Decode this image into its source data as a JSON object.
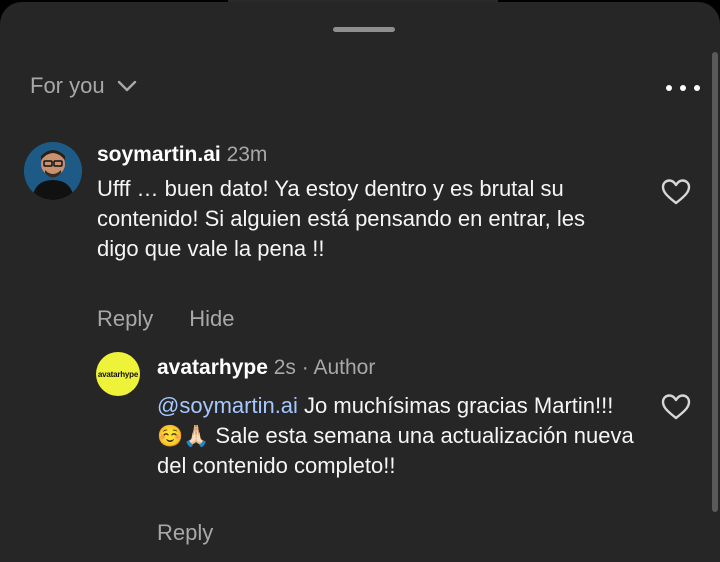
{
  "sheet": {
    "filter_label": "For you",
    "filter_icon": "chevron-down-icon",
    "more_icon": "more-horizontal-icon"
  },
  "comments": [
    {
      "username": "soymartin.ai",
      "time": "23m",
      "text": "Ufff … buen dato! Ya estoy dentro y es brutal su contenido! Si alguien está pensando en entrar, les digo que vale la pena !!",
      "reply_label": "Reply",
      "hide_label": "Hide",
      "like_icon": "heart-outline-icon"
    }
  ],
  "reply": {
    "username": "avatarhype",
    "time": "2s",
    "separator": "·",
    "author_label": "Author",
    "avatar_text": "avatarhype",
    "mention": "@soymartin.ai",
    "text_part1": " Jo muchísimas gracias Martin!!! ",
    "emojis": "☺️🙏🏻",
    "text_part2": " Sale esta semana una actualización nueva del contenido completo!!",
    "reply_label": "Reply",
    "like_icon": "heart-outline-icon"
  },
  "colors": {
    "sheet_bg": "#262626",
    "secondary_text": "#a8a8a8",
    "mention": "#a6c8ff",
    "avatarhype_bg": "#eef33a"
  }
}
